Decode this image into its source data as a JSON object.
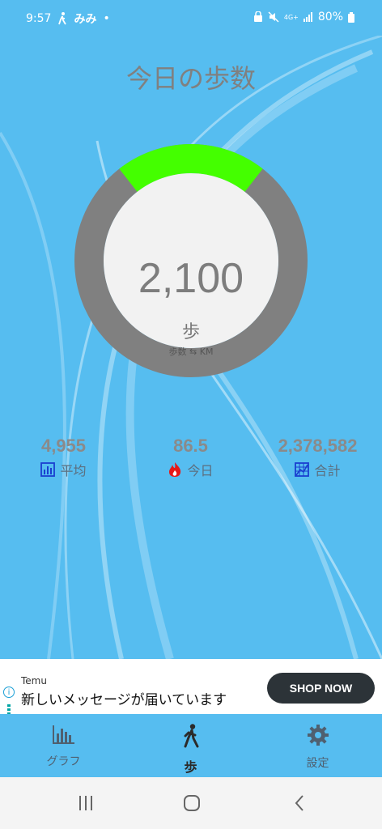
{
  "status_bar": {
    "time": "9:57",
    "app_badge": "みみ",
    "dot": "•",
    "battery": "80%",
    "network": "4G+"
  },
  "page": {
    "title": "今日の歩数"
  },
  "gauge": {
    "value": "2,100",
    "unit": "歩",
    "toggle_label": "歩数 ⇆ KM",
    "progress_start_deg": -38,
    "progress_end_deg": 38,
    "track_color": "#808080",
    "progress_color": "#44ff00"
  },
  "stats": [
    {
      "value": "4,955",
      "label": "平均",
      "icon": "bar-chart-icon"
    },
    {
      "value": "86.5",
      "label": "今日",
      "icon": "flame-icon"
    },
    {
      "value": "2,378,582",
      "label": "合計",
      "icon": "grid-chart-icon"
    }
  ],
  "ad": {
    "brand": "Temu",
    "message": "新しいメッセージが届いています",
    "cta": "SHOP NOW",
    "info": "i"
  },
  "bottom_nav": [
    {
      "label": "グラフ",
      "icon": "graph-icon",
      "active": false
    },
    {
      "label": "歩",
      "icon": "walk-icon",
      "active": true
    },
    {
      "label": "設定",
      "icon": "gear-icon",
      "active": false
    }
  ],
  "colors": {
    "background": "#56bdf0",
    "active_nav": "#2b2b2b",
    "inactive_nav": "#4f6070"
  }
}
